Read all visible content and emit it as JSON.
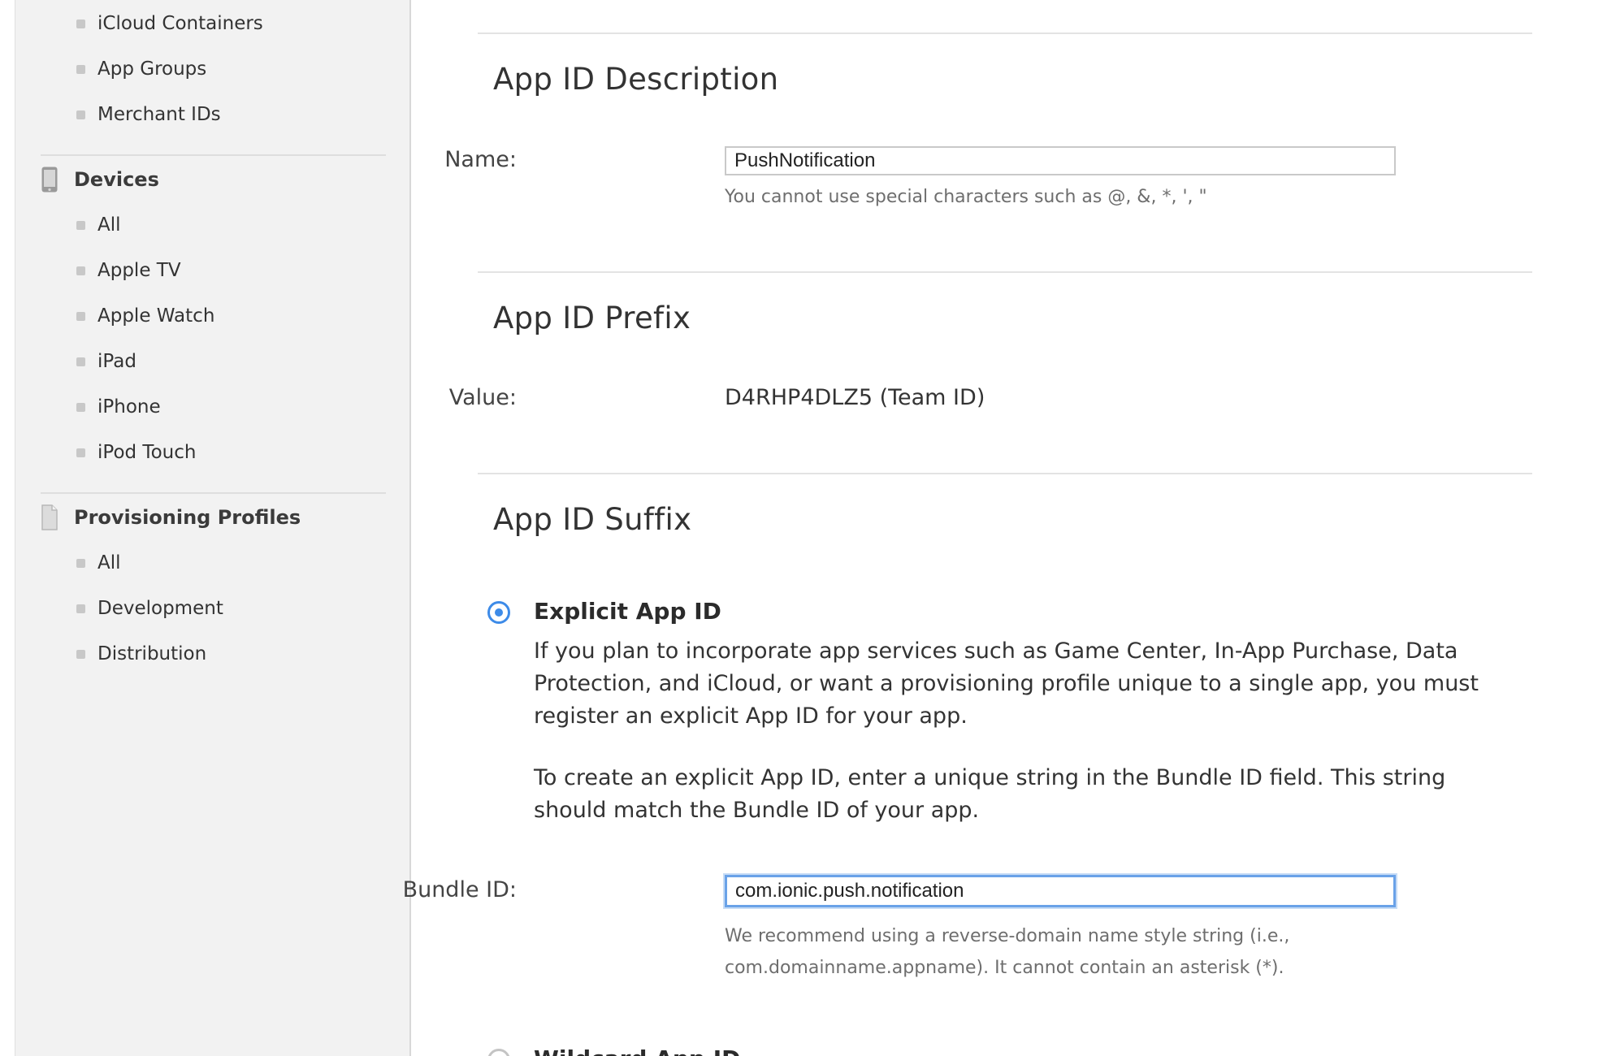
{
  "sidebar": {
    "top_items": [
      {
        "label": "iCloud Containers"
      },
      {
        "label": "App Groups"
      },
      {
        "label": "Merchant IDs"
      }
    ],
    "devices": {
      "heading": "Devices",
      "icon": "device-phone-icon",
      "items": [
        {
          "label": "All"
        },
        {
          "label": "Apple TV"
        },
        {
          "label": "Apple Watch"
        },
        {
          "label": "iPad"
        },
        {
          "label": "iPhone"
        },
        {
          "label": "iPod Touch"
        }
      ]
    },
    "provisioning": {
      "heading": "Provisioning Profiles",
      "icon": "document-icon",
      "items": [
        {
          "label": "All"
        },
        {
          "label": "Development"
        },
        {
          "label": "Distribution"
        }
      ]
    }
  },
  "description": {
    "title": "App ID Description",
    "name_label": "Name:",
    "name_value": "PushNotification",
    "name_hint": "You cannot use special characters such as @, &, *, ', \""
  },
  "prefix": {
    "title": "App ID Prefix",
    "value_label": "Value:",
    "value": "D4RHP4DLZ5 (Team ID)"
  },
  "suffix": {
    "title": "App ID Suffix",
    "explicit": {
      "title": "Explicit App ID",
      "selected": true,
      "paragraph1": "If you plan to incorporate app services such as Game Center, In-App Purchase, Data Protection, and iCloud, or want a provisioning profile unique to a single app, you must register an explicit App ID for your app.",
      "paragraph2": "To create an explicit App ID, enter a unique string in the Bundle ID field. This string should match the Bundle ID of your app.",
      "bundle_label": "Bundle ID:",
      "bundle_value": "com.ionic.push.notification",
      "bundle_hint_line1": "We recommend using a reverse-domain name style string (i.e.,",
      "bundle_hint_line2": "com.domainname.appname). It cannot contain an asterisk (*)."
    },
    "wildcard": {
      "title": "Wildcard App ID",
      "selected": false
    }
  },
  "colors": {
    "accent": "#3d8be8",
    "focus_border": "#6aa2e8",
    "sidebar_bg": "#f2f2f2"
  }
}
